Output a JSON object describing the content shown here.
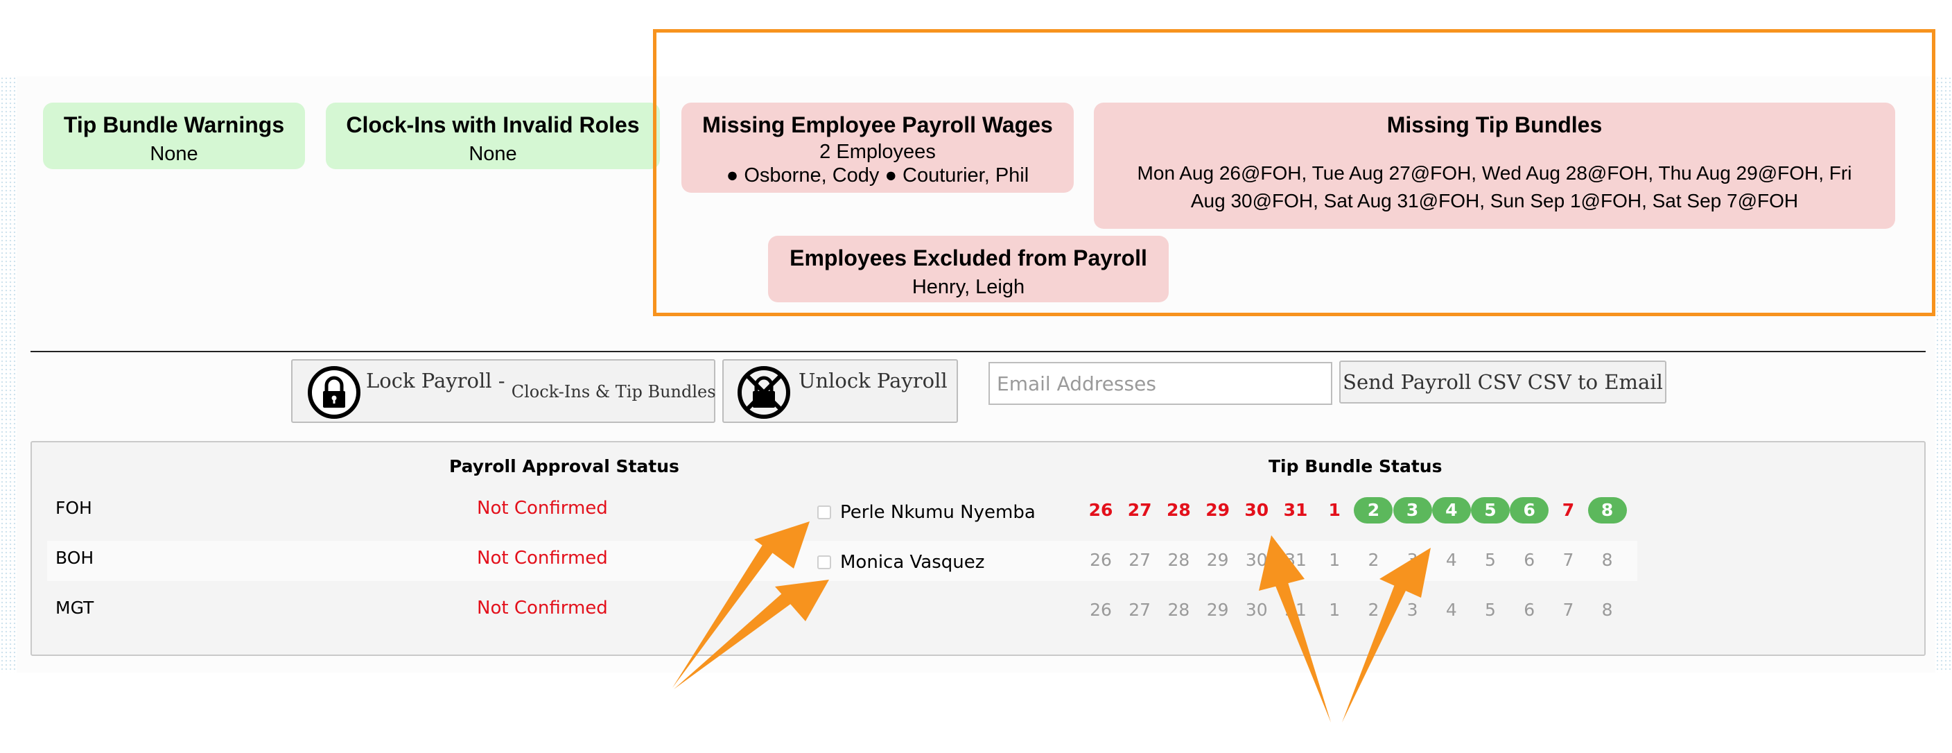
{
  "summary_cards": {
    "tip_bundle_warnings": {
      "title": "Tip Bundle Warnings",
      "value": "None"
    },
    "invalid_roles": {
      "title": "Clock-Ins with Invalid Roles",
      "value": "None"
    },
    "missing_wages": {
      "title": "Missing Employee Payroll Wages",
      "count": "2 Employees",
      "names": "● Osborne, Cody ● Couturier, Phil"
    },
    "missing_tip_bundles": {
      "title": "Missing Tip Bundles",
      "value": "Mon Aug 26@FOH, Tue Aug 27@FOH, Wed Aug 28@FOH, Thu Aug 29@FOH, Fri Aug 30@FOH, Sat Aug 31@FOH, Sun Sep 1@FOH, Sat Sep 7@FOH"
    },
    "excluded": {
      "title": "Employees Excluded from Payroll",
      "value": "Henry, Leigh"
    }
  },
  "actions": {
    "lock_label": "Lock Payroll - ",
    "lock_sub": "Clock-Ins & Tip Bundles",
    "unlock_label": "Unlock Payroll",
    "email_placeholder": "Email Addresses",
    "email_value": "",
    "send_label": "Send Payroll CSV CSV to Email"
  },
  "status_panel": {
    "approval_header": "Payroll Approval Status",
    "tip_header": "Tip Bundle Status",
    "rows": [
      {
        "dept": "FOH",
        "status": "Not Confirmed",
        "approver": "Perle Nkumu Nyemba"
      },
      {
        "dept": "BOH",
        "status": "Not Confirmed",
        "approver": "Monica Vasquez"
      },
      {
        "dept": "MGT",
        "status": "Not Confirmed",
        "approver": ""
      }
    ],
    "days": [
      "26",
      "27",
      "28",
      "29",
      "30",
      "31",
      "1",
      "2",
      "3",
      "4",
      "5",
      "6",
      "7",
      "8"
    ],
    "foh_day_states": [
      "missing",
      "missing",
      "missing",
      "missing",
      "missing",
      "missing",
      "missing",
      "complete",
      "complete",
      "complete",
      "complete",
      "complete",
      "missing",
      "complete"
    ],
    "colors": {
      "missing": "#e3101b",
      "complete": "#5cb85c",
      "inactive": "#9a9a9a",
      "highlight": "#f7931e"
    }
  }
}
